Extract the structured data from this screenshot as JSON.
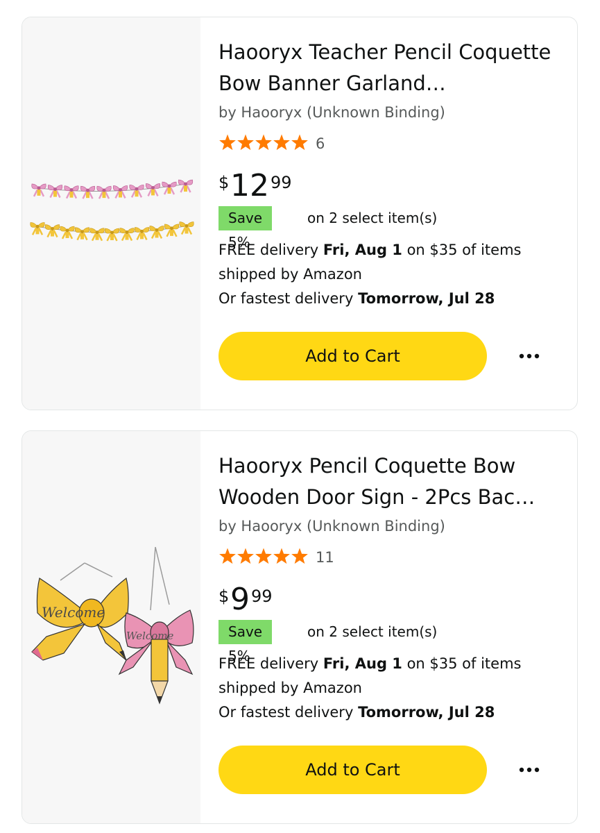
{
  "colors": {
    "star": "#ff7b00",
    "save_badge": "#7fda69",
    "cart_button": "#ffd814"
  },
  "products": [
    {
      "title": "Haooryx Teacher Pencil Coquette Bow Banner Garland…",
      "byline": "by Haooryx (Unknown Binding)",
      "rating": 5,
      "rating_count": "6",
      "price": {
        "symbol": "$",
        "whole": "12",
        "fraction": "99"
      },
      "save_badge": "Save 5%",
      "save_text": "on 2 select item(s)",
      "delivery": {
        "free_prefix": "FREE delivery ",
        "free_date": "Fri, Aug 1",
        "free_suffix": " on $35 of items shipped by Amazon",
        "fast_prefix": "Or fastest delivery ",
        "fast_date": "Tomorrow, Jul 28"
      },
      "cart_label": "Add to Cart",
      "image_icon": "bow-garland-banner-image"
    },
    {
      "title": "Haooryx Pencil Coquette Bow Wooden Door Sign - 2Pcs Bac…",
      "byline": "by Haooryx (Unknown Binding)",
      "rating": 5,
      "rating_count": "11",
      "price": {
        "symbol": "$",
        "whole": "9",
        "fraction": "99"
      },
      "save_badge": "Save 5%",
      "save_text": "on 2 select item(s)",
      "delivery": {
        "free_prefix": "FREE delivery ",
        "free_date": "Fri, Aug 1",
        "free_suffix": " on $35 of items shipped by Amazon",
        "fast_prefix": "Or fastest delivery ",
        "fast_date": "Tomorrow, Jul 28"
      },
      "cart_label": "Add to Cart",
      "image_icon": "bow-welcome-door-sign-image",
      "image_sign_text": "Welcome"
    }
  ]
}
